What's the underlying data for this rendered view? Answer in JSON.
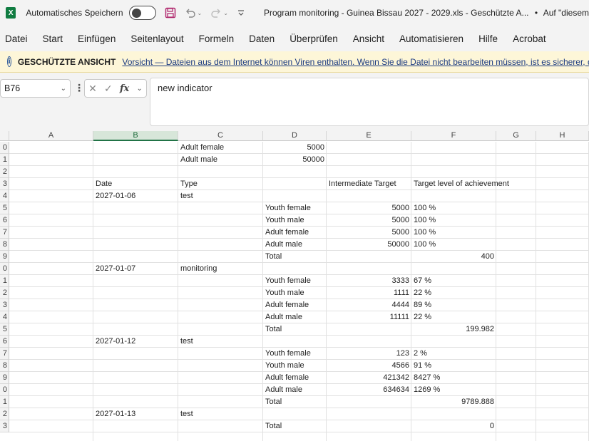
{
  "titlebar": {
    "app_icon": "excel-logo-icon",
    "app_letter": "X",
    "autosave_label": "Automatisches Speichern",
    "autosave_state": "off",
    "document_title": "Program monitoring - Guinea Bissau 2027 - 2029.xls",
    "separator": "-",
    "protected_title": "Geschützte A...",
    "dot": "•",
    "location": "Auf \"diesem"
  },
  "menu": {
    "items": [
      "Datei",
      "Start",
      "Einfügen",
      "Seitenlayout",
      "Formeln",
      "Daten",
      "Überprüfen",
      "Ansicht",
      "Automatisieren",
      "Hilfe",
      "Acrobat"
    ]
  },
  "protected_view": {
    "title": "GESCHÜTZTE ANSICHT",
    "message": "Vorsicht — Dateien aus dem Internet können Viren enthalten. Wenn Sie die Datei nicht bearbeiten müssen, ist es sicherer, die"
  },
  "formula_bar": {
    "name_box": "B76",
    "formula": "new indicator"
  },
  "grid": {
    "columns": [
      "A",
      "B",
      "C",
      "D",
      "E",
      "F",
      "G",
      "H"
    ],
    "selected_column": "B",
    "row_labels": [
      "0",
      "1",
      "2",
      "3",
      "4",
      "5",
      "6",
      "7",
      "8",
      "9",
      "0",
      "1",
      "2",
      "3",
      "4",
      "5",
      "6",
      "7",
      "8",
      "9",
      "0",
      "1",
      "2",
      "3"
    ],
    "rows": [
      {
        "C": "Adult female",
        "D": "5000"
      },
      {
        "C": "Adult male",
        "D": "50000"
      },
      {},
      {
        "B": "Date",
        "C": "Type",
        "E": "Intermediate Target",
        "F": "Target level of achievement"
      },
      {
        "B": "2027-01-06",
        "C": "test"
      },
      {
        "D": "Youth female",
        "E": "5000",
        "F": "100 %"
      },
      {
        "D": "Youth male",
        "E": "5000",
        "F": "100 %"
      },
      {
        "D": "Adult female",
        "E": "5000",
        "F": "100 %"
      },
      {
        "D": "Adult male",
        "E": "50000",
        "F": "100 %"
      },
      {
        "D": "Total",
        "F": "400"
      },
      {
        "B": "2027-01-07",
        "C": "monitoring"
      },
      {
        "D": "Youth female",
        "E": "3333",
        "F": "67 %"
      },
      {
        "D": "Youth male",
        "E": "1111",
        "F": "22 %"
      },
      {
        "D": "Adult female",
        "E": "4444",
        "F": "89 %"
      },
      {
        "D": "Adult male",
        "E": "11111",
        "F": "22 %"
      },
      {
        "D": "Total",
        "F": "199.982"
      },
      {
        "B": "2027-01-12",
        "C": "test"
      },
      {
        "D": "Youth female",
        "E": "123",
        "F": "2 %"
      },
      {
        "D": "Youth male",
        "E": "4566",
        "F": "91 %"
      },
      {
        "D": "Adult female",
        "E": "421342",
        "F": "8427 %"
      },
      {
        "D": "Adult male",
        "E": "634634",
        "F": "1269 %"
      },
      {
        "D": "Total",
        "F": "9789.888"
      },
      {
        "B": "2027-01-13",
        "C": "test"
      },
      {
        "D": "Total",
        "F": "0"
      }
    ]
  }
}
